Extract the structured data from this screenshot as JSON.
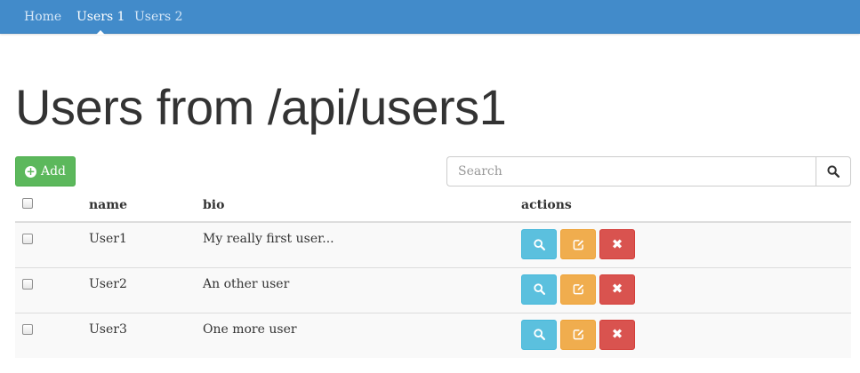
{
  "navbar": {
    "items": [
      {
        "label": "Home",
        "active": false
      },
      {
        "label": "Users 1",
        "active": true
      },
      {
        "label": "Users 2",
        "active": false
      }
    ]
  },
  "page": {
    "title": "Users from /api/users1"
  },
  "toolbar": {
    "add_label": "Add",
    "add_icon": "plus-circle-icon",
    "search_placeholder": "Search",
    "search_value": "",
    "search_icon": "search-icon"
  },
  "table": {
    "headers": {
      "name": "name",
      "bio": "bio",
      "actions": "actions"
    },
    "rows": [
      {
        "name": "User1",
        "bio": "My really first user...",
        "checked": false
      },
      {
        "name": "User2",
        "bio": "An other user",
        "checked": false
      },
      {
        "name": "User3",
        "bio": "One more user",
        "checked": false
      }
    ],
    "row_actions": [
      {
        "name": "view",
        "icon": "search-icon",
        "color": "#5bc0de"
      },
      {
        "name": "edit",
        "icon": "edit-icon",
        "color": "#f0ad4e"
      },
      {
        "name": "delete",
        "icon": "close-icon",
        "color": "#d9534f"
      }
    ]
  },
  "colors": {
    "navbar": "#428bca",
    "success": "#5cb85c",
    "info": "#5bc0de",
    "warning": "#f0ad4e",
    "danger": "#d9534f"
  }
}
